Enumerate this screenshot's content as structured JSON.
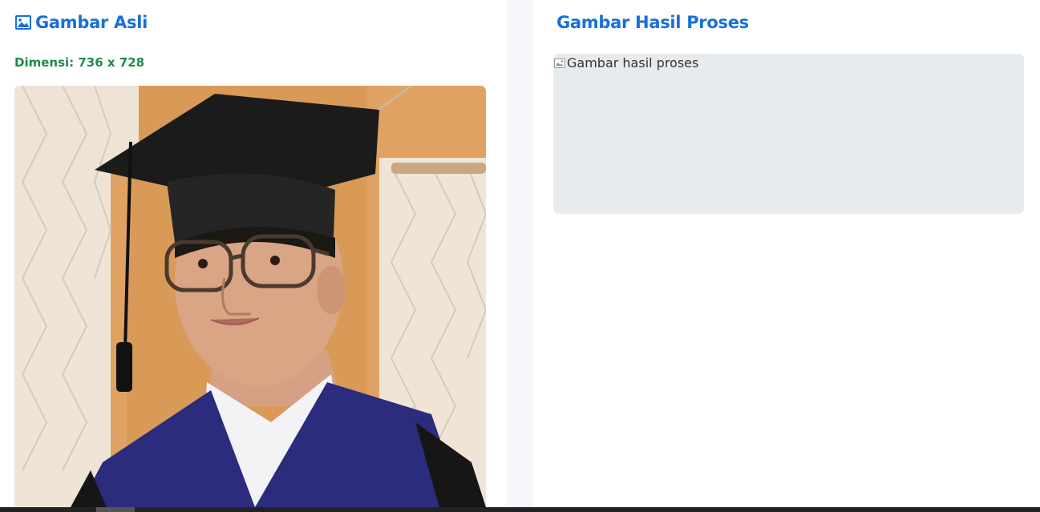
{
  "original": {
    "title": "Gambar Asli",
    "icon": "image-icon",
    "dimension_text": "Dimensi: 736 x 728",
    "photo_alt": "Graduation portrait"
  },
  "result": {
    "title": "Gambar Hasil Proses",
    "image_alt": "Gambar hasil proses",
    "icon": "broken-image-icon"
  },
  "colors": {
    "title_blue": "#1a6fd9",
    "dimension_green": "#1f8a4c",
    "placeholder_bg": "#e8ebee",
    "page_bg": "#f5f7fa"
  }
}
